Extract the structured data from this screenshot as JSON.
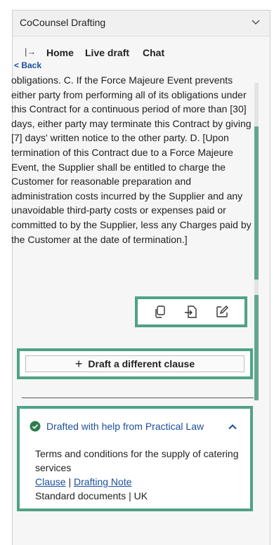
{
  "app": {
    "title": "CoCounsel Drafting"
  },
  "nav": {
    "pane_toggle": "|→",
    "tabs": [
      {
        "label": "Home"
      },
      {
        "label": "Live draft"
      },
      {
        "label": "Chat"
      }
    ],
    "back_label": "< Back"
  },
  "clause": {
    "text": "obligations. C. If the Force Majeure Event prevents either party from performing all of its obligations under this Contract for a continuous period of more than [30] days, either party may terminate this Contract by giving [7] days' written notice to the other party. D. [Upon termination of this Contract due to a Force Majeure Event, the Supplier shall be entitled to charge the Customer for reasonable preparation and administration costs incurred by the Supplier and any unavoidable third-party costs or expenses paid or committed to by the Supplier, less any Charges paid by the Customer at the date of termination.]"
  },
  "actions": {
    "icons": [
      "copy-icon",
      "insert-icon",
      "edit-icon"
    ]
  },
  "draft_button": {
    "plus": "+",
    "label": "Draft a different clause"
  },
  "info": {
    "title": "Drafted with help from Practical Law",
    "doc_title": "Terms and conditions for the supply of catering services",
    "link_clause": "Clause",
    "separator": " | ",
    "link_note": "Drafting Note",
    "meta": "Standard documents | UK"
  },
  "colors": {
    "accent": "#4fa384",
    "link": "#1a4f9c",
    "check": "#2e7d4f"
  }
}
